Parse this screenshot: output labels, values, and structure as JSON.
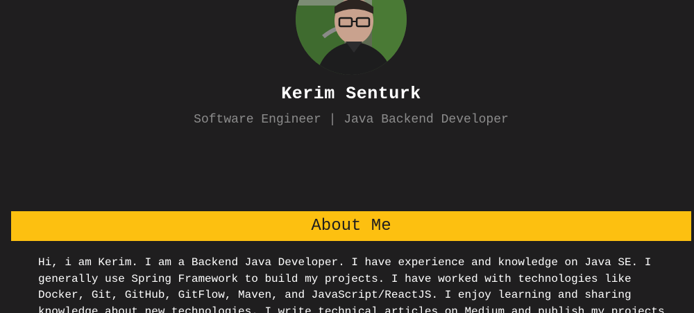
{
  "profile": {
    "name": "Kerim Senturk",
    "subtitle": "Software Engineer | Java Backend Developer"
  },
  "about": {
    "heading": "About Me",
    "text": "Hi, i am Kerim. I am a Backend Java Developer. I have experience and knowledge on Java SE. I generally use Spring Framework to build my projects. I have worked with technologies like Docker, Git, GitHub, GitFlow, Maven, and JavaScript/ReactJS. I enjoy learning and sharing knowledge about new technologies. I write technical articles on Medium and publish my projects"
  },
  "colors": {
    "background": "#1f1e1f",
    "accent": "#fdc010",
    "subtitle": "#8c8c8c"
  }
}
